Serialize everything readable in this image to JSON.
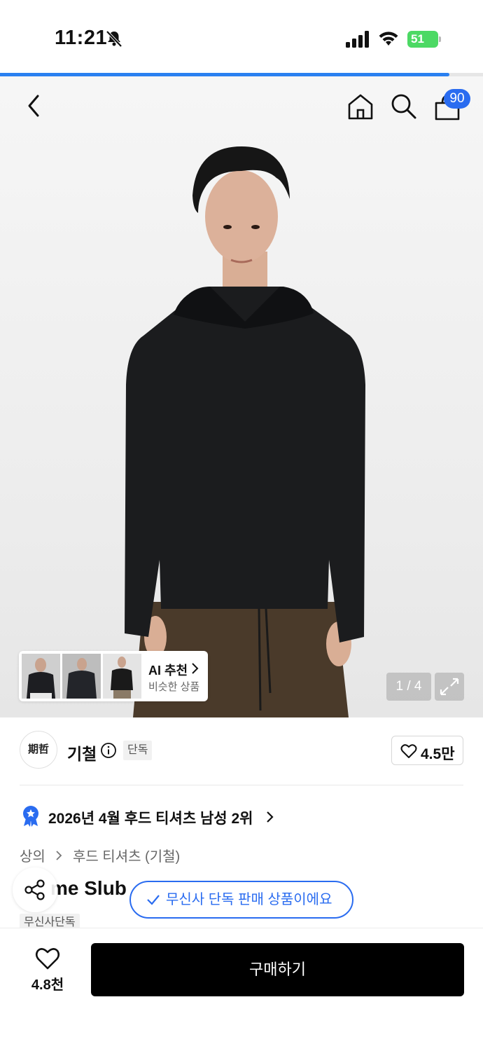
{
  "status_bar": {
    "time": "11:21",
    "battery": "51"
  },
  "page_progress": 0.93,
  "header": {
    "cart_count": "90"
  },
  "gallery": {
    "ai_title": "AI 추천",
    "ai_subtitle": "비슷한 상품",
    "pager": "1 / 4"
  },
  "brand": {
    "logo_text": "期哲",
    "name": "기철",
    "tag": "단독",
    "likes": "4.5만"
  },
  "ranking": {
    "text": "2026년 4월 후드 티셔츠 남성 2위"
  },
  "breadcrumb": {
    "level1": "상의",
    "level2": "후드 티셔츠 (기철)"
  },
  "product": {
    "name_visible": "me Slub",
    "sub_tag": "무신사단독",
    "toast": "무신사 단독 판매 상품이에요"
  },
  "bottom": {
    "wish_count": "4.8천",
    "buy_label": "구매하기"
  },
  "colors": {
    "accent": "#2a6cf0",
    "battery": "#4cd964",
    "buy_button": "#000000"
  }
}
